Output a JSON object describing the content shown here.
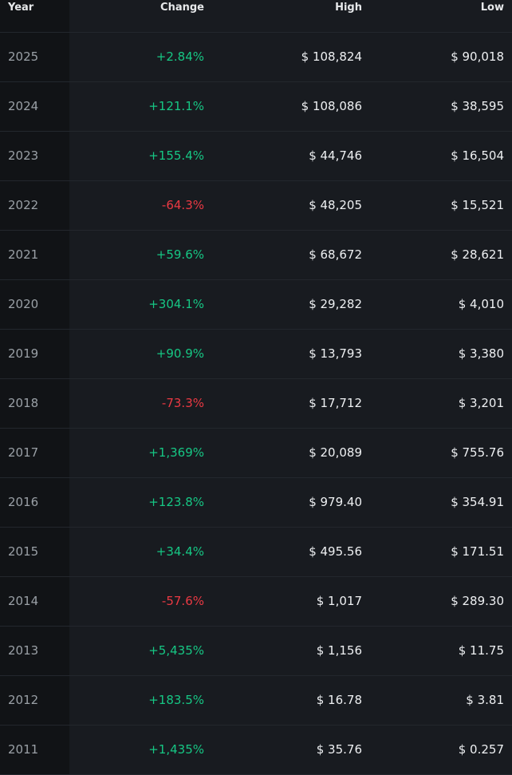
{
  "table": {
    "headers": {
      "year": "Year",
      "change": "Change",
      "high": "High",
      "low": "Low"
    },
    "colors": {
      "positive": "#16c784",
      "negative": "#ea3943"
    },
    "rows": [
      {
        "year": "2025",
        "change": "+2.84%",
        "high": "$ 108,824",
        "low": "$ 90,018"
      },
      {
        "year": "2024",
        "change": "+121.1%",
        "high": "$ 108,086",
        "low": "$ 38,595"
      },
      {
        "year": "2023",
        "change": "+155.4%",
        "high": "$ 44,746",
        "low": "$ 16,504"
      },
      {
        "year": "2022",
        "change": "-64.3%",
        "high": "$ 48,205",
        "low": "$ 15,521"
      },
      {
        "year": "2021",
        "change": "+59.6%",
        "high": "$ 68,672",
        "low": "$ 28,621"
      },
      {
        "year": "2020",
        "change": "+304.1%",
        "high": "$ 29,282",
        "low": "$ 4,010"
      },
      {
        "year": "2019",
        "change": "+90.9%",
        "high": "$ 13,793",
        "low": "$ 3,380"
      },
      {
        "year": "2018",
        "change": "-73.3%",
        "high": "$ 17,712",
        "low": "$ 3,201"
      },
      {
        "year": "2017",
        "change": "+1,369%",
        "high": "$ 20,089",
        "low": "$ 755.76"
      },
      {
        "year": "2016",
        "change": "+123.8%",
        "high": "$ 979.40",
        "low": "$ 354.91"
      },
      {
        "year": "2015",
        "change": "+34.4%",
        "high": "$ 495.56",
        "low": "$ 171.51"
      },
      {
        "year": "2014",
        "change": "-57.6%",
        "high": "$ 1,017",
        "low": "$ 289.30"
      },
      {
        "year": "2013",
        "change": "+5,435%",
        "high": "$ 1,156",
        "low": "$ 11.75"
      },
      {
        "year": "2012",
        "change": "+183.5%",
        "high": "$ 16.78",
        "low": "$ 3.81"
      },
      {
        "year": "2011",
        "change": "+1,435%",
        "high": "$ 35.76",
        "low": "$ 0.257"
      }
    ]
  }
}
